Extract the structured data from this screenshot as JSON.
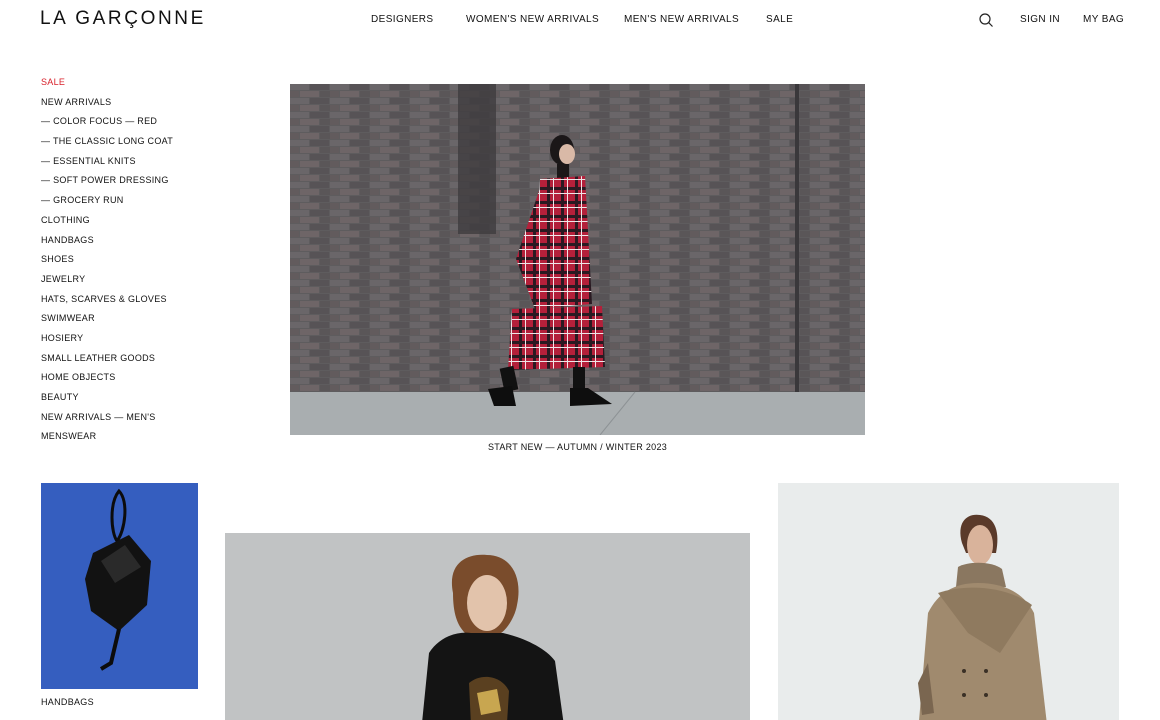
{
  "brand": {
    "logo_text": "LA GARÇONNE"
  },
  "topnav": {
    "items": [
      "DESIGNERS",
      "WOMEN'S NEW ARRIVALS",
      "MEN'S NEW ARRIVALS",
      "SALE"
    ]
  },
  "utility": {
    "search_icon": "search-icon",
    "sign_in": "SIGN IN",
    "bag": "MY BAG"
  },
  "sidebar": {
    "items": [
      {
        "label": "SALE",
        "highlight_color": "#d8202a"
      },
      {
        "label": "NEW ARRIVALS"
      },
      {
        "label": "— COLOR FOCUS — RED"
      },
      {
        "label": "— THE CLASSIC LONG COAT"
      },
      {
        "label": "— ESSENTIAL KNITS"
      },
      {
        "label": "— SOFT POWER DRESSING"
      },
      {
        "label": "— GROCERY RUN"
      },
      {
        "label": "CLOTHING"
      },
      {
        "label": "HANDBAGS"
      },
      {
        "label": "SHOES"
      },
      {
        "label": "JEWELRY"
      },
      {
        "label": "HATS, SCARVES & GLOVES"
      },
      {
        "label": "SWIMWEAR"
      },
      {
        "label": "HOSIERY"
      },
      {
        "label": "SMALL LEATHER GOODS"
      },
      {
        "label": "HOME OBJECTS"
      },
      {
        "label": "BEAUTY"
      },
      {
        "label": "NEW ARRIVALS — MEN'S"
      },
      {
        "label": "MENSWEAR"
      }
    ]
  },
  "hero": {
    "caption": "START NEW — AUTUMN / WINTER 2023"
  },
  "tiles": {
    "handbags_label": "HANDBAGS"
  },
  "colors": {
    "accent_sale": "#d8202a",
    "text": "#111111",
    "background": "#ffffff"
  }
}
